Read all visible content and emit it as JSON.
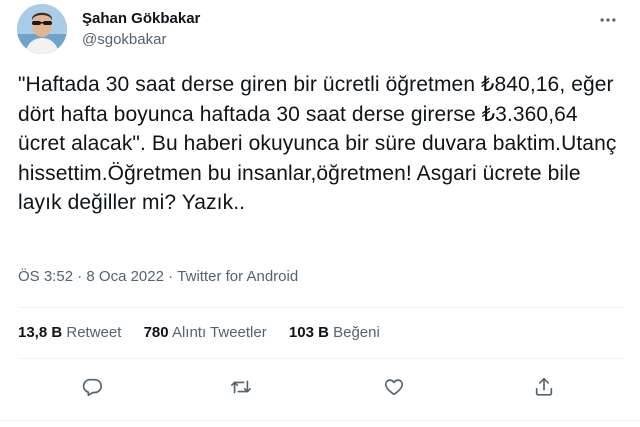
{
  "author": {
    "name": "Şahan Gökbakar",
    "handle": "@sgokbakar"
  },
  "tweet": {
    "text": "\"Haftada 30 saat derse giren bir ücretli öğretmen ₺840,16, eğer dört hafta boyunca haftada 30 saat derse girerse ₺3.360,64 ücret alacak\". Bu haberi okuyunca bir süre duvara baktim.Utanç hissettim.Öğretmen bu insanlar,öğretmen! Asgari ücrete bile layık değiller mi? Yazık..",
    "time": "ÖS 3:52",
    "separator": "·",
    "date": "8 Oca 2022",
    "source": "Twitter for Android"
  },
  "stats": {
    "retweets_count": "13,8 B",
    "retweets_label": "Retweet",
    "quotes_count": "780",
    "quotes_label": "Alıntı Tweetler",
    "likes_count": "103 B",
    "likes_label": "Beğeni"
  },
  "icons": {
    "more": "more-dots-icon",
    "reply": "reply-icon",
    "retweet": "retweet-icon",
    "like": "heart-icon",
    "share": "share-icon"
  },
  "colors": {
    "text": "#0f1419",
    "secondary": "#536471",
    "divider": "#eff3f4"
  }
}
